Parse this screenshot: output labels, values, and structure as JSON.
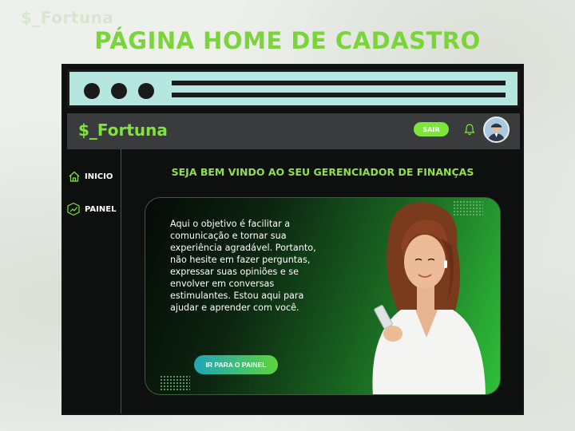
{
  "corner_logo": "$_Fortuna",
  "page_heading": "PÁGINA HOME DE CADASTRO",
  "header": {
    "brand": "$_Fortuna",
    "logout_label": "SAIR"
  },
  "sidebar": {
    "items": [
      {
        "label": "INICIO",
        "icon": "home-icon"
      },
      {
        "label": "PAINEL",
        "icon": "chart-icon"
      }
    ]
  },
  "main": {
    "welcome": "SEJA BEM VINDO AO SEU GERENCIADOR DE FINANÇAS",
    "hero_text": "Aqui o objetivo é facilitar a comunicação e tornar sua experiência agradável. Portanto, não hesite em fazer perguntas, expressar suas opiniões e se envolver em conversas estimulantes. Estou aqui para ajudar e aprender com você.",
    "cta_label": "IR PARA O PAINEL"
  },
  "colors": {
    "accent": "#7ee53a",
    "heading": "#7bd53a",
    "browser_bar": "#b6e6e0",
    "frame": "#0e0f0f",
    "header": "#3a3b3c"
  }
}
